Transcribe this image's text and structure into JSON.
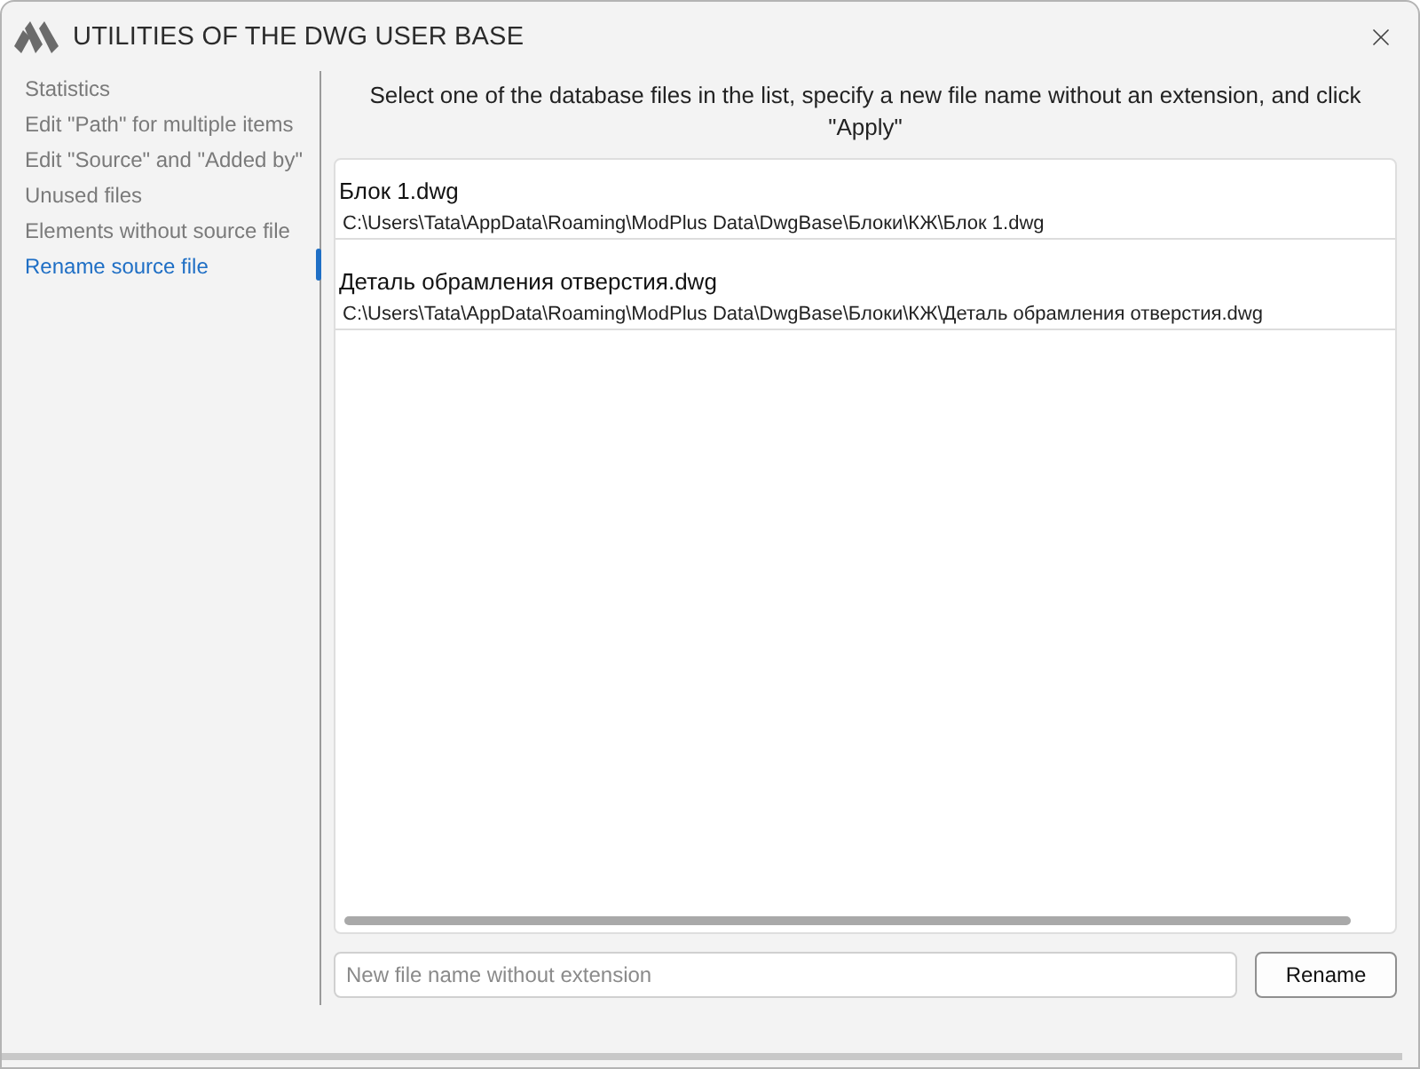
{
  "window": {
    "title": "UTILITIES OF THE DWG USER BASE"
  },
  "sidebar": {
    "items": [
      {
        "label": "Statistics",
        "selected": false
      },
      {
        "label": "Edit \"Path\" for multiple items",
        "selected": false
      },
      {
        "label": "Edit \"Source\" and \"Added by\"",
        "selected": false
      },
      {
        "label": "Unused files",
        "selected": false
      },
      {
        "label": "Elements without source file",
        "selected": false
      },
      {
        "label": "Rename source file",
        "selected": true
      }
    ]
  },
  "instruction": "Select one of the database files in the list, specify a new file name without an extension, and click \"Apply\"",
  "files": [
    {
      "name": "Блок 1.dwg",
      "path": "C:\\Users\\Tata\\AppData\\Roaming\\ModPlus Data\\DwgBase\\Блоки\\КЖ\\Блок 1.dwg",
      "selected": false
    },
    {
      "name": "Деталь обрамления отверстия.dwg",
      "path": "C:\\Users\\Tata\\AppData\\Roaming\\ModPlus Data\\DwgBase\\Блоки\\КЖ\\Деталь обрамления отверстия.dwg",
      "selected": false
    }
  ],
  "new_name_field": {
    "placeholder": "New file name without extension"
  },
  "rename_button": {
    "label": "Rename"
  }
}
